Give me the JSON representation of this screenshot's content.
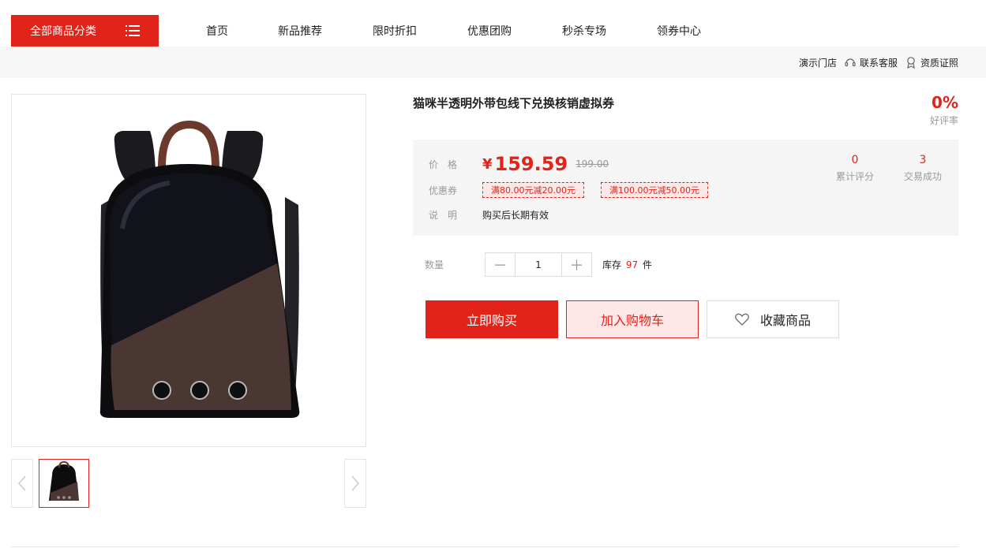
{
  "nav": {
    "category_button": "全部商品分类",
    "links": [
      "首页",
      "新品推荐",
      "限时折扣",
      "优惠团购",
      "秒杀专场",
      "领券中心"
    ]
  },
  "subbar": {
    "store": "演示门店",
    "service": "联系客服",
    "license": "资质证照"
  },
  "product": {
    "title": "猫咪半透明外带包线下兑换核销虚拟券",
    "rating_value": "0%",
    "rating_label": "好评率",
    "price_label": "价　格",
    "currency": "¥",
    "price": "159.59",
    "original_price": "199.00",
    "coupon_label": "优惠券",
    "coupons": [
      "满80.00元减20.00元",
      "满100.00元减50.00元"
    ],
    "note_label": "说　明",
    "note": "购买后长期有效",
    "stats": [
      {
        "value": "0",
        "label": "累计评分"
      },
      {
        "value": "3",
        "label": "交易成功"
      }
    ],
    "qty_label": "数量",
    "qty_minus": "－",
    "qty_value": "1",
    "qty_plus": "＋",
    "stock_prefix": "库存",
    "stock_count": "97",
    "stock_unit": "件",
    "buy_label": "立即购买",
    "cart_label": "加入购物车",
    "fav_label": "收藏商品"
  },
  "colors": {
    "accent": "#e2231a",
    "accent_light": "#fde7e7",
    "price_box_bg": "#f5f5f5"
  }
}
